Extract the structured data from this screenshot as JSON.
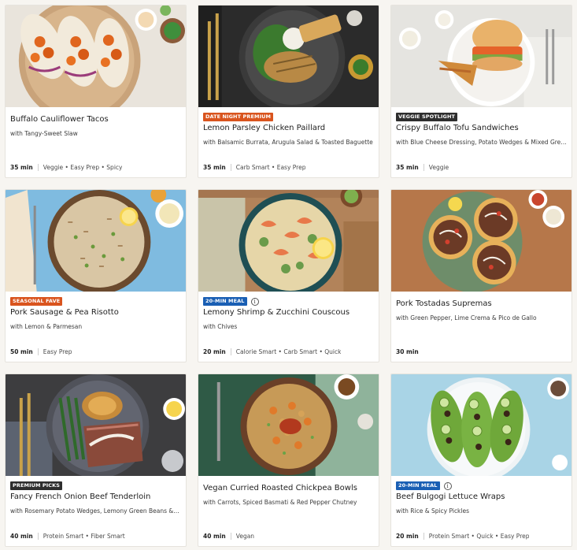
{
  "recipes": [
    {
      "title": "Buffalo Cauliflower Tacos",
      "subtitle": "with Tangy-Sweet Slaw",
      "badge": "",
      "badge_color": "",
      "time": "35 min",
      "tags": "Veggie • Easy Prep • Spicy"
    },
    {
      "title": "Lemon Parsley Chicken Paillard",
      "subtitle": "with Balsamic Burrata, Arugula Salad & Toasted Baguette",
      "badge": "DATE NIGHT PREMIUM",
      "badge_color": "orange",
      "time": "35 min",
      "tags": "Carb Smart • Easy Prep"
    },
    {
      "title": "Crispy Buffalo Tofu Sandwiches",
      "subtitle": "with Blue Cheese Dressing, Potato Wedges & Mixed Greens",
      "badge": "VEGGIE SPOTLIGHT",
      "badge_color": "dark",
      "time": "35 min",
      "tags": "Veggie"
    },
    {
      "title": "Pork Sausage & Pea Risotto",
      "subtitle": "with Lemon & Parmesan",
      "badge": "SEASONAL FAVE",
      "badge_color": "orange",
      "time": "50 min",
      "tags": "Easy Prep"
    },
    {
      "title": "Lemony Shrimp & Zucchini Couscous",
      "subtitle": "with Chives",
      "badge": "20-MIN MEAL",
      "badge_color": "blue",
      "info_icon": true,
      "time": "20 min",
      "tags": "Calorie Smart • Carb Smart • Quick"
    },
    {
      "title": "Pork Tostadas Supremas",
      "subtitle": "with Green Pepper, Lime Crema & Pico de Gallo",
      "badge": "",
      "badge_color": "",
      "time": "30 min",
      "tags": ""
    },
    {
      "title": "Fancy French Onion Beef Tenderloin",
      "subtitle": "with Rosemary Potato Wedges, Lemony Green Beans & Crispy Onions",
      "badge": "PREMIUM PICKS",
      "badge_color": "dark",
      "time": "40 min",
      "tags": "Protein Smart • Fiber Smart"
    },
    {
      "title": "Vegan Curried Roasted Chickpea Bowls",
      "subtitle": "with Carrots, Spiced Basmati & Red Pepper Chutney",
      "badge": "",
      "badge_color": "",
      "time": "40 min",
      "tags": "Vegan"
    },
    {
      "title": "Beef Bulgogi Lettuce Wraps",
      "subtitle": "with Rice & Spicy Pickles",
      "badge": "20-MIN MEAL",
      "badge_color": "blue",
      "info_icon": true,
      "time": "20 min",
      "tags": "Protein Smart • Quick • Easy Prep"
    }
  ],
  "info_glyph": "i",
  "colors": {
    "page_bg": "#f7f5f1",
    "badge_orange": "#d9541e",
    "badge_dark": "#2e2e2e",
    "badge_blue": "#1a5fb4"
  },
  "photos": [
    "tacos-photo",
    "chicken-paillard-photo",
    "tofu-sandwich-photo",
    "risotto-photo",
    "shrimp-couscous-photo",
    "tostadas-photo",
    "beef-tenderloin-photo",
    "chickpea-bowl-photo",
    "lettuce-wraps-photo"
  ]
}
